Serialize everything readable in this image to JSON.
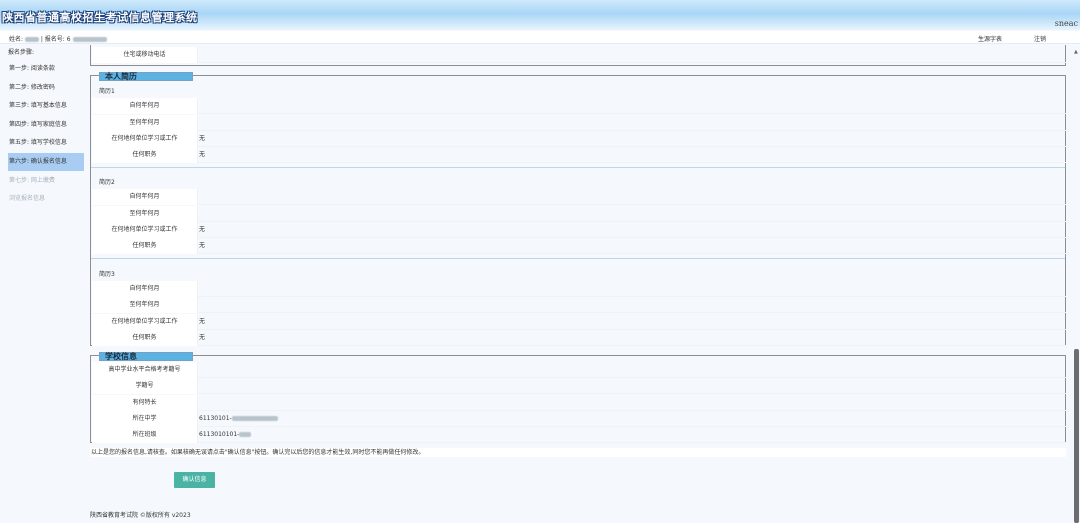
{
  "header": {
    "system_title": "陕西省普通高校招生考试信息管理系统",
    "brand": "sneac"
  },
  "userbar": {
    "name_label": "姓名:",
    "separator": "| 报名号:",
    "prefix": "6",
    "print_form": "生源字表",
    "logout": "注销"
  },
  "sidebar": {
    "title": "报名步骤:",
    "steps": [
      {
        "label": "第一步: 阅读条款"
      },
      {
        "label": "第二步: 修改密码"
      },
      {
        "label": "第三步: 填写基本信息"
      },
      {
        "label": "第四步: 填写家庭信息"
      },
      {
        "label": "第五步: 填写学校信息"
      },
      {
        "label": "第六步: 确认报名信息",
        "active": true
      },
      {
        "label": "第七步: 网上缴费",
        "disabled": true
      },
      {
        "label": "浏览报名信息",
        "disabled": true
      }
    ]
  },
  "top_fragment": {
    "phone_label": "住宅或移动电话"
  },
  "resume": {
    "legend": "本人简历",
    "entries": [
      {
        "title": "简历1",
        "rows": [
          {
            "label": "自何年何月",
            "value": ""
          },
          {
            "label": "至何年何月",
            "value": ""
          },
          {
            "label": "在何地何单位学习或工作",
            "value": "无"
          },
          {
            "label": "任何职务",
            "value": "无"
          }
        ]
      },
      {
        "title": "简历2",
        "rows": [
          {
            "label": "自何年何月",
            "value": ""
          },
          {
            "label": "至何年何月",
            "value": ""
          },
          {
            "label": "在何地何单位学习或工作",
            "value": "无"
          },
          {
            "label": "任何职务",
            "value": "无"
          }
        ]
      },
      {
        "title": "简历3",
        "rows": [
          {
            "label": "自何年何月",
            "value": ""
          },
          {
            "label": "至何年何月",
            "value": ""
          },
          {
            "label": "在何地何单位学习或工作",
            "value": "无"
          },
          {
            "label": "任何职务",
            "value": "无"
          }
        ]
      }
    ]
  },
  "school": {
    "legend": "学校信息",
    "rows": [
      {
        "label": "高中学业水平合格考考籍号",
        "value": ""
      },
      {
        "label": "学籍号",
        "value": ""
      },
      {
        "label": "有何特长",
        "value": ""
      },
      {
        "label": "所在中学",
        "value": "61130101-"
      },
      {
        "label": "所在班级",
        "value": "6113010101-"
      }
    ]
  },
  "notice": "以上是您的报名信息,请核查。如果核确无误请点击\"确认信息\"按钮。确认完以后您的信息才能生效,同时您不能再做任何修改。",
  "confirm_button": "确认信息",
  "footer": "陕西省教育考试院 ©版权所有 v2023"
}
